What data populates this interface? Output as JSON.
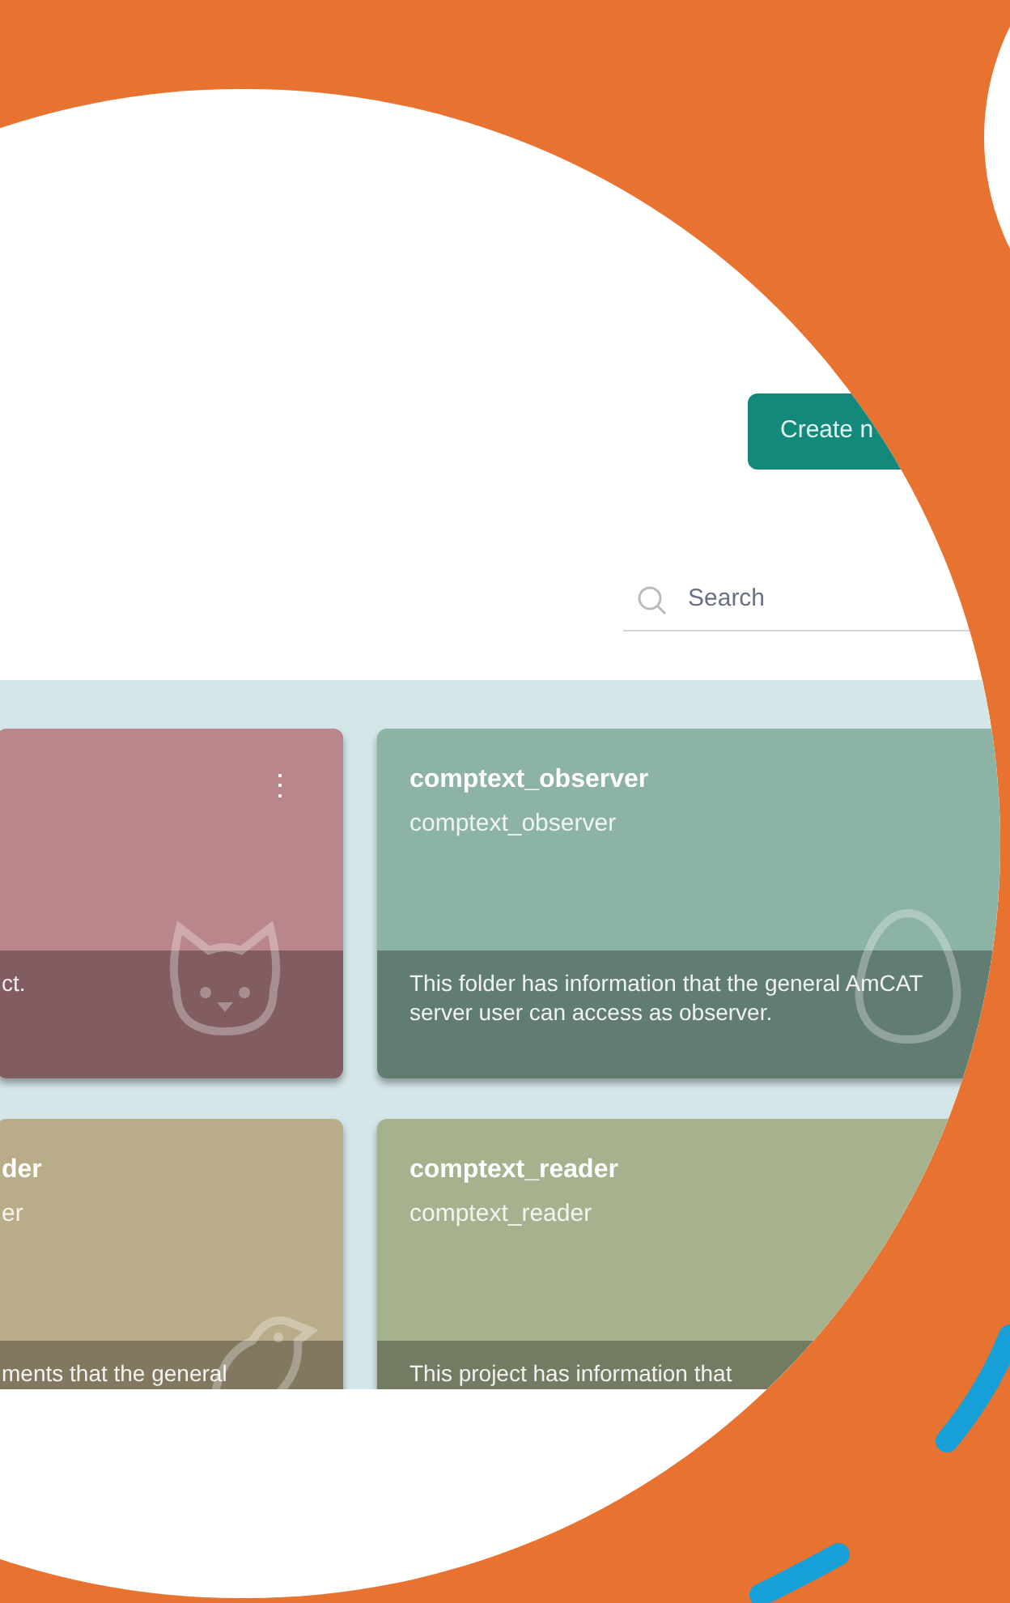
{
  "header": {
    "create_button": "Create n",
    "search": {
      "placeholder": "Search"
    }
  },
  "projects": [
    {
      "description": "ct.",
      "color": "#b9868b",
      "menu": "⋮"
    },
    {
      "title": "comptext_observer",
      "subtitle": "comptext_observer",
      "description": "This folder has information that the general AmCAT server user can access as observer.",
      "color": "#8cb3a4"
    },
    {
      "title": "der",
      "subtitle": "er",
      "description": "ments that the general",
      "color": "#b9ac88"
    },
    {
      "title": "comptext_reader",
      "subtitle": "comptext_reader",
      "description": "This project has information that",
      "color": "#a6b18e"
    }
  ]
}
